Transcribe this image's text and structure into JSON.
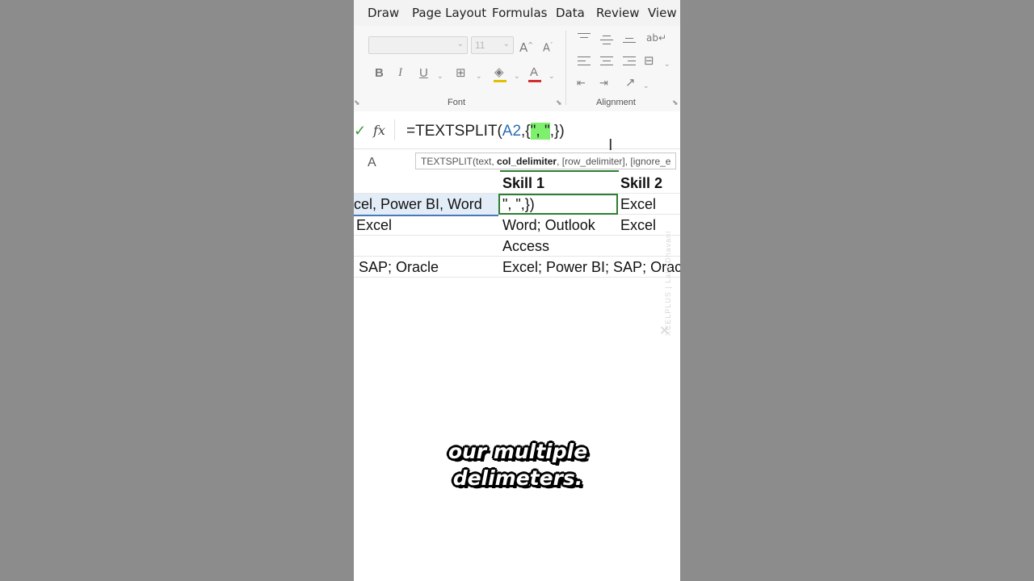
{
  "ribbon_tabs": [
    "Draw",
    "Page Layout",
    "Formulas",
    "Data",
    "Review",
    "View"
  ],
  "font_group": {
    "label": "Font",
    "font_name": "",
    "font_size": "11",
    "bold": "B",
    "italic": "I",
    "underline": "U",
    "font_color": "A"
  },
  "alignment_group": {
    "label": "Alignment"
  },
  "formula_bar": {
    "prefix": "=TEXTSPLIT(",
    "ref": "A2",
    "mid": ",{",
    "highlight": "\", \"",
    "suffix": ",})"
  },
  "tooltip": {
    "pre": "TEXTSPLIT(text, ",
    "bold_arg": "col_delimiter",
    "post": ", [row_delimiter], [ignore_e"
  },
  "column_header_a": "A",
  "rows": [
    {
      "a": "",
      "b": "Skill 1",
      "c": "Skill 2"
    },
    {
      "a": "cel, Power BI, Word",
      "b": "\", \",})",
      "c": "Excel"
    },
    {
      "a": "Excel",
      "b": "Word; Outlook",
      "c": "Excel"
    },
    {
      "a": "",
      "b": "Access",
      "c": ""
    },
    {
      "a": "SAP; Oracle",
      "b": "Excel; Power BI; SAP; Oracl",
      "c": ""
    }
  ],
  "watermark": "XCELPLUS | Lalit Dhavani",
  "caption": {
    "line1": "our multiple",
    "line2": "delimeters."
  },
  "colors": {
    "active_cell_border": "#2e7d32",
    "highlight": "#7ef06e",
    "reference": "#2a6db5"
  }
}
